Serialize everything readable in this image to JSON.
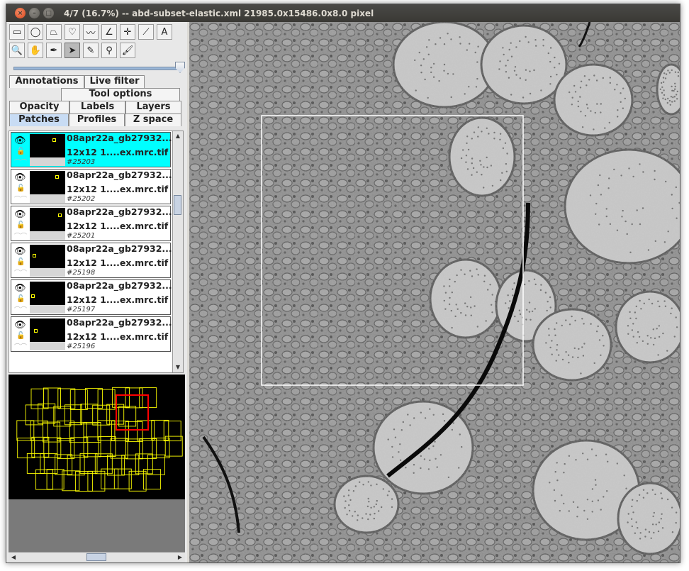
{
  "window": {
    "title": "4/7  (16.7%) -- abd-subset-elastic.xml  21985.0x15486.0x8.0 pixel"
  },
  "tools": [
    {
      "name": "rectangle-tool-icon",
      "glyph": "▭"
    },
    {
      "name": "ellipse-tool-icon",
      "glyph": "◯"
    },
    {
      "name": "polygon-tool-icon",
      "glyph": "⏢"
    },
    {
      "name": "freehand-tool-icon",
      "glyph": "♡"
    },
    {
      "name": "polyline-tool-icon",
      "glyph": "〰"
    },
    {
      "name": "angle-tool-icon",
      "glyph": "∠"
    },
    {
      "name": "point-tool-icon",
      "glyph": "✛"
    },
    {
      "name": "wand-tool-icon",
      "glyph": "⟋"
    },
    {
      "name": "text-tool-icon",
      "glyph": "A"
    },
    {
      "name": "zoom-tool-icon",
      "glyph": "🔍"
    },
    {
      "name": "hand-tool-icon",
      "glyph": "✋"
    },
    {
      "name": "dropper-tool-icon",
      "glyph": "✒"
    },
    {
      "name": "select-tool-icon",
      "glyph": "➤"
    },
    {
      "name": "pencil-tool-icon",
      "glyph": "✎"
    },
    {
      "name": "pen-tool-icon",
      "glyph": "⚲"
    },
    {
      "name": "brush-tool-icon",
      "glyph": "🖌"
    }
  ],
  "tabs": {
    "row1": [
      "Annotations",
      "Live filter"
    ],
    "row2": [
      "Tool options"
    ],
    "row3": [
      "Opacity",
      "Labels",
      "Layers"
    ],
    "row4": [
      "Patches",
      "Profiles",
      "Z space"
    ],
    "active": "Patches"
  },
  "patches": [
    {
      "name": "08apr22a_gb27932...",
      "file": "12x12 1....ex.mrc.tif",
      "id": "#25203",
      "selected": true
    },
    {
      "name": "08apr22a_gb27932...",
      "file": "12x12 1....ex.mrc.tif",
      "id": "#25202",
      "selected": false
    },
    {
      "name": "08apr22a_gb27932...",
      "file": "12x12 1....ex.mrc.tif",
      "id": "#25201",
      "selected": false
    },
    {
      "name": "08apr22a_gb27932...",
      "file": "12x12 1....ex.mrc.tif",
      "id": "#25198",
      "selected": false
    },
    {
      "name": "08apr22a_gb27932...",
      "file": "12x12 1....ex.mrc.tif",
      "id": "#25197",
      "selected": false
    },
    {
      "name": "08apr22a_gb27932...",
      "file": "12x12 1....ex.mrc.tif",
      "id": "#25196",
      "selected": false
    }
  ],
  "colors": {
    "selected_row": "#00ffff",
    "minimap_grid": "#ffff00",
    "minimap_view": "#ff0000",
    "canvas_view_box": "#ffffff"
  },
  "ui_glyphs": {
    "close": "×",
    "min": "–",
    "max": "□",
    "eye": "👁",
    "lock": "🔓",
    "link": "⌒⌒",
    "up": "▲",
    "down": "▼",
    "left": "◀",
    "right": "▶"
  }
}
